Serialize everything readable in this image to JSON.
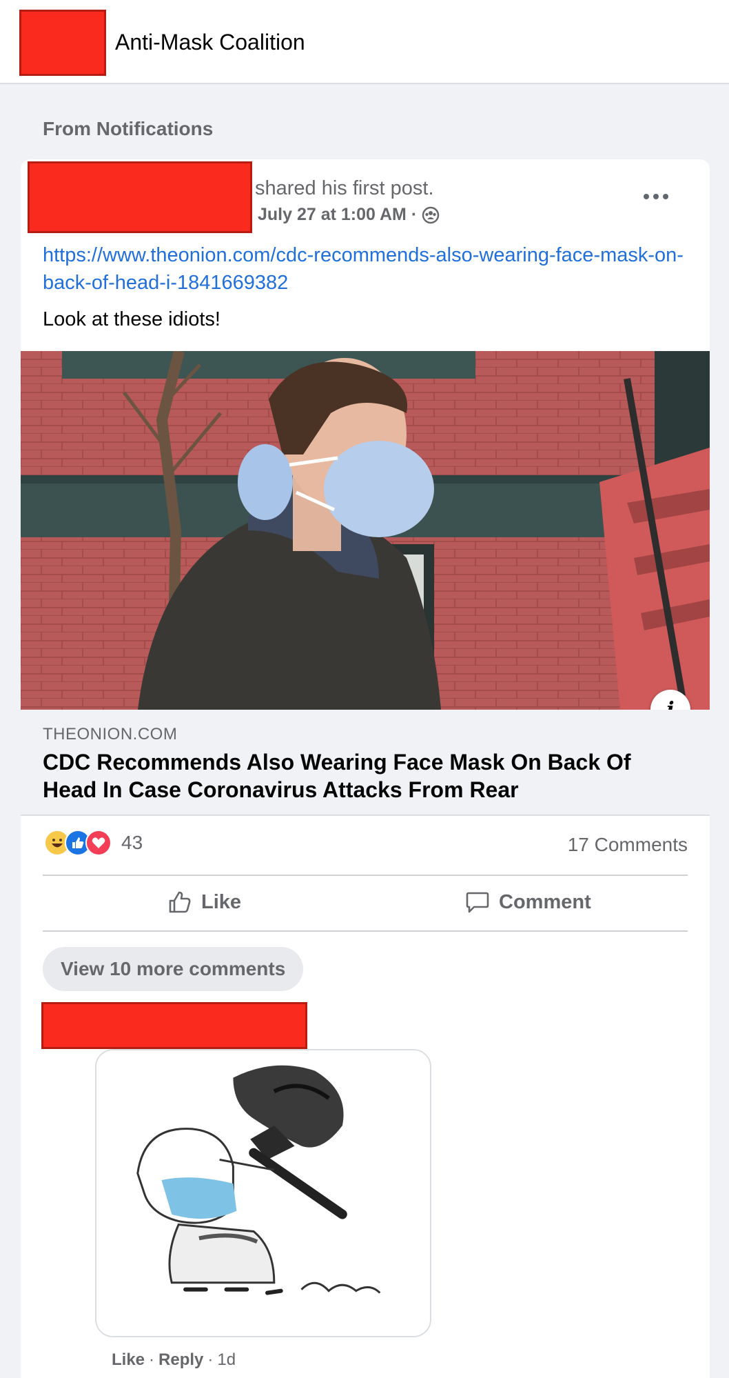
{
  "header": {
    "group_name": "Anti-Mask Coalition"
  },
  "feed": {
    "section_label": "From Notifications"
  },
  "post": {
    "action_text": "shared his first post.",
    "timestamp": "July 27 at 1:00 AM",
    "separator": "·",
    "audience_icon": "group-icon",
    "link_url": "https://www.theonion.com/cdc-recommends-also-wearing-face-mask-on-back-of-head-i-1841669382",
    "text": "Look at these idiots!",
    "link_preview": {
      "domain": "THEONION.COM",
      "title": "CDC Recommends Also Wearing Face Mask On Back Of Head In Case Coronavirus Attacks From Rear"
    },
    "reaction_count": "43",
    "comments_count": "17 Comments",
    "like_label": "Like",
    "comment_label": "Comment",
    "view_more_label": "View 10 more comments"
  },
  "comment": {
    "like_label": "Like",
    "reply_label": "Reply",
    "sep": "·",
    "age": "1d"
  },
  "colors": {
    "redaction": "#fa2b1e",
    "link_blue": "#216fdb",
    "secondary_text": "#65676b",
    "like_blue": "#1b74e4",
    "love_red": "#f33e58",
    "haha_yellow": "#f7c94a"
  }
}
